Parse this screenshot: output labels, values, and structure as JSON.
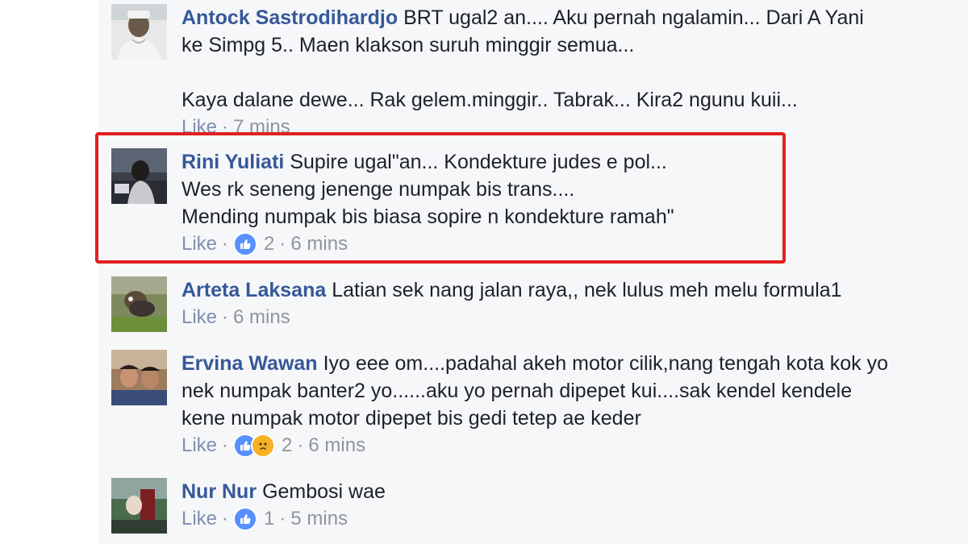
{
  "comments": [
    {
      "author": "Antock Sastrodihardjo",
      "text_lines": [
        "BRT ugal2 an.... Aku pernah ngalamin... Dari A Yani",
        "ke Simpg 5.. Maen klakson suruh minggir semua...",
        "",
        "Kaya dalane dewe... Rak gelem.minggir.. Tabrak... Kira2 ngunu kuii..."
      ],
      "like_label": "Like",
      "time": "7 mins"
    },
    {
      "author": "Rini Yuliati",
      "text_lines": [
        "Supire ugal\"an... Kondekture judes e pol...",
        "Wes rk seneng jenenge numpak bis trans....",
        "Mending numpak bis biasa sopire n kondekture ramah\""
      ],
      "like_label": "Like",
      "reactions": [
        "like-icon"
      ],
      "reaction_count": "2",
      "time": "6 mins"
    },
    {
      "author": "Arteta Laksana",
      "text_lines": [
        "Latian sek nang jalan raya,, nek lulus meh melu formula1"
      ],
      "like_label": "Like",
      "time": "6 mins"
    },
    {
      "author": "Ervina Wawan",
      "text_lines": [
        "Iyo eee om....padahal akeh motor cilik,nang tengah kota kok yo",
        "nek numpak banter2 yo......aku yo pernah dipepet kui....sak kendel kendele",
        "kene numpak motor dipepet bis gedi tetep ae keder"
      ],
      "like_label": "Like",
      "reactions": [
        "like-icon",
        "sad-icon"
      ],
      "reaction_count": "2",
      "time": "6 mins"
    },
    {
      "author": "Nur Nur",
      "text_lines": [
        "Gembosi wae"
      ],
      "like_label": "Like",
      "reactions": [
        "like-icon"
      ],
      "reaction_count": "1",
      "time": "5 mins"
    }
  ],
  "colors": {
    "author": "#365899",
    "text": "#1d2129",
    "meta": "#90949c",
    "like_reaction": "#5890ff",
    "sad_reaction": "#f7b125",
    "highlight": "#e02020",
    "panel_bg": "#f6f7f9"
  }
}
